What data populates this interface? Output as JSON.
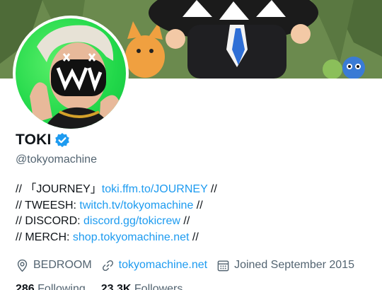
{
  "profile": {
    "display_name": "TOKI",
    "handle": "@tokyomachine",
    "verified": true
  },
  "bio": [
    {
      "prefix": "// 「JOURNEY」",
      "link": "toki.ffm.to/JOURNEY",
      "suffix": " //"
    },
    {
      "prefix": "// TWEESH: ",
      "link": "twitch.tv/tokyomachine",
      "suffix": " //"
    },
    {
      "prefix": "// DISCORD: ",
      "link": "discord.gg/tokicrew",
      "suffix": " //"
    },
    {
      "prefix": "// MERCH: ",
      "link": "shop.tokyomachine.net",
      "suffix": " //"
    }
  ],
  "meta": {
    "location": "BEDROOM",
    "website": "tokyomachine.net",
    "joined": "Joined September 2015"
  },
  "stats": {
    "following_count": "286",
    "following_label": "Following",
    "followers_count": "23.3K",
    "followers_label": "Followers"
  },
  "colors": {
    "link": "#1d9bf0",
    "secondary_text": "#536471",
    "primary_text": "#0f1419",
    "verified": "#1d9bf0",
    "avatar_bg": "#22d84a"
  },
  "icons": {
    "location": "location-pin-icon",
    "website": "link-icon",
    "joined": "calendar-icon",
    "verified": "verified-badge-icon"
  }
}
